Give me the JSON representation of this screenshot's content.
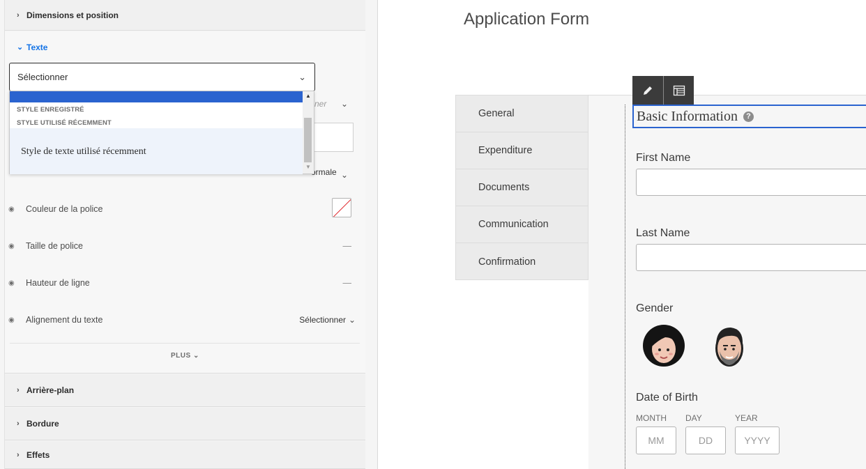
{
  "panel": {
    "sections": {
      "dimensions": "Dimensions et position",
      "texte": "Texte",
      "arriere_plan": "Arrière-plan",
      "bordure": "Bordure",
      "effets": "Effets"
    },
    "style_select": {
      "value": "Sélectionner",
      "dropdown": {
        "group_saved": "STYLE ENREGISTRÉ",
        "group_recent": "STYLE UTILISÉ RÉCEMMENT",
        "option_recent": "Style de texte utilisé récemment"
      }
    },
    "obscured": {
      "font_select_fragment": "ner",
      "weight_value_fragment": "ormale"
    },
    "properties": {
      "couleur": "Couleur de la police",
      "taille": "Taille de police",
      "taille_value": "—",
      "hauteur": "Hauteur de ligne",
      "hauteur_value": "—",
      "alignement": "Alignement du texte",
      "alignement_value": "Sélectionner"
    },
    "plus": "PLUS"
  },
  "canvas": {
    "title": "Application Form",
    "tabs": [
      "General",
      "Expenditure",
      "Documents",
      "Communication",
      "Confirmation"
    ],
    "panel_title": "Basic Information",
    "help": "?",
    "fields": {
      "first_name": "First Name",
      "last_name": "Last Name",
      "gender": "Gender",
      "dob": "Date of Birth",
      "month": "MONTH",
      "day": "DAY",
      "year": "YEAR",
      "month_ph": "MM",
      "day_ph": "DD",
      "year_ph": "YYYY"
    }
  },
  "colors": {
    "accent": "#1473e6",
    "selection": "#2a63cf",
    "toolbar": "#3b3b3b"
  },
  "icons": [
    "chevron-right-icon",
    "chevron-down-icon",
    "eye-icon",
    "pencil-icon",
    "table-icon",
    "help-icon",
    "female-avatar-icon",
    "male-avatar-icon"
  ]
}
